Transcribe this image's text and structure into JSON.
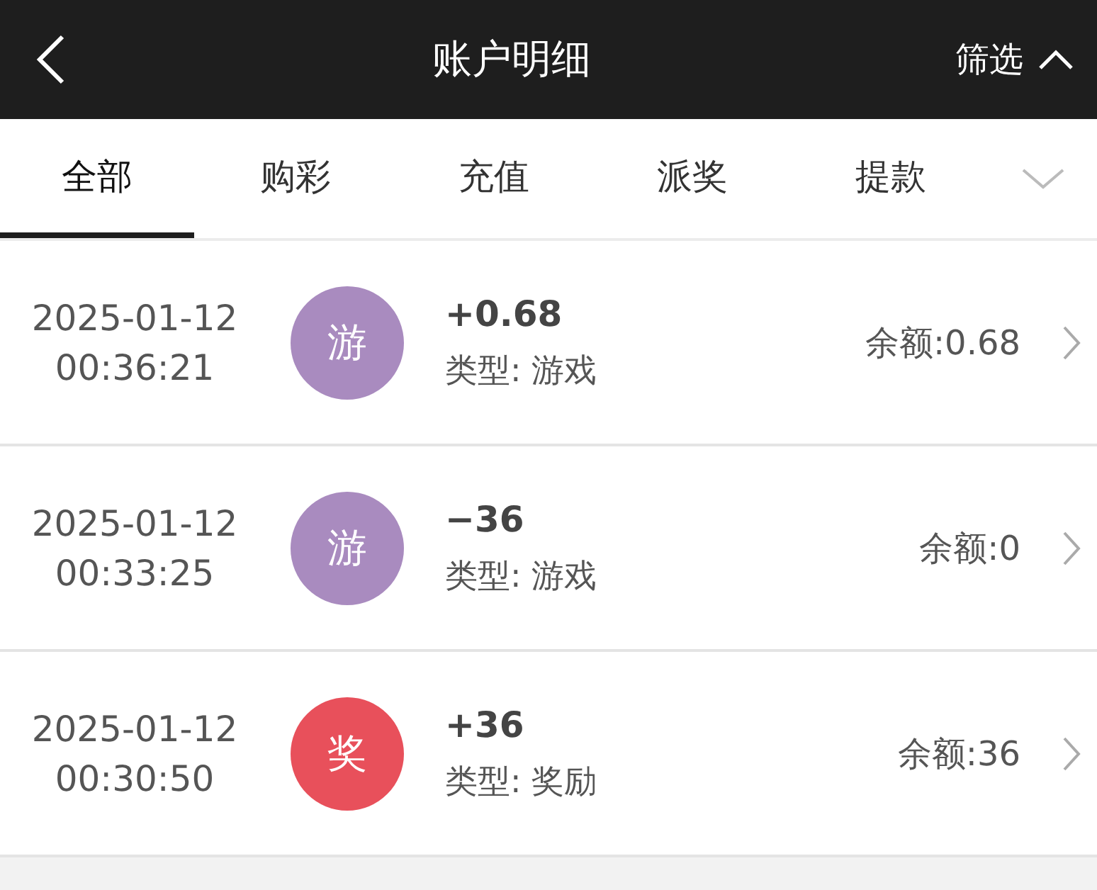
{
  "header": {
    "title": "账户明细",
    "filter": "筛选"
  },
  "tabs": [
    {
      "label": "全部",
      "selected": true
    },
    {
      "label": "购彩",
      "selected": false
    },
    {
      "label": "充值",
      "selected": false
    },
    {
      "label": "派奖",
      "selected": false
    },
    {
      "label": "提款",
      "selected": false
    }
  ],
  "records": [
    {
      "date": "2025-01-12",
      "time": "00:36:21",
      "badge": "游",
      "color": "#a98bbf",
      "amount": "+0.68",
      "type": "类型: 游戏",
      "balance": "余额:0.68"
    },
    {
      "date": "2025-01-12",
      "time": "00:33:25",
      "badge": "游",
      "color": "#a98bbf",
      "amount": "−36",
      "type": "类型: 游戏",
      "balance": "余额:0"
    },
    {
      "date": "2025-01-12",
      "time": "00:30:50",
      "badge": "奖",
      "color": "#e8505b",
      "amount": "+36",
      "type": "类型: 奖励",
      "balance": "余额:36"
    }
  ]
}
